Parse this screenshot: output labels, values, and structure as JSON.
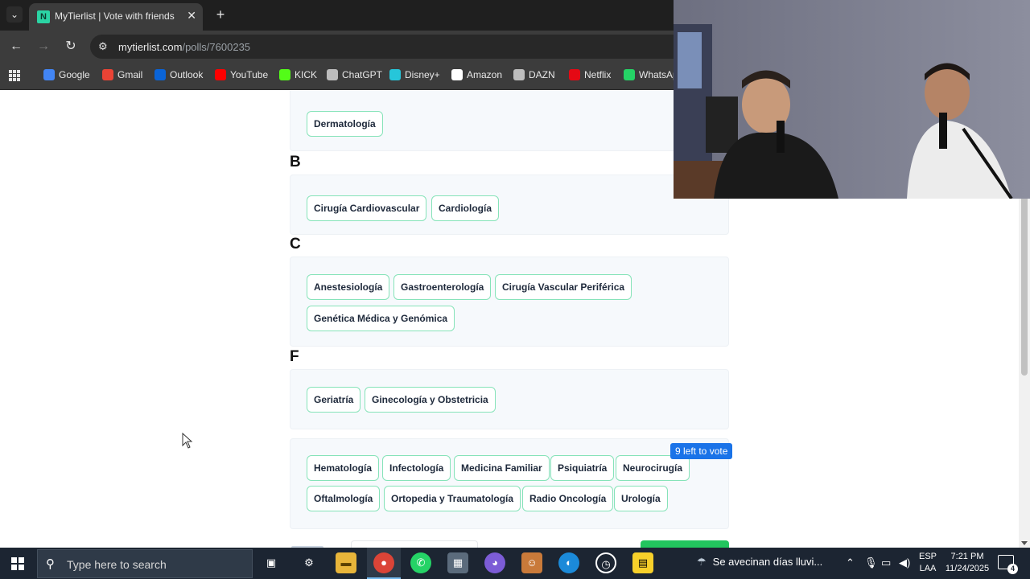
{
  "browser": {
    "tab_title": "MyTierlist | Vote with friends",
    "url_domain": "mytierlist.com",
    "url_path": "/polls/7600235",
    "bookmarks": [
      {
        "label": "Google",
        "icon": "google-icon",
        "color": "#4285f4"
      },
      {
        "label": "Gmail",
        "icon": "gmail-icon",
        "color": "#ea4335"
      },
      {
        "label": "Outlook",
        "icon": "outlook-icon",
        "color": "#0a64d8"
      },
      {
        "label": "YouTube",
        "icon": "youtube-icon",
        "color": "#ff0000"
      },
      {
        "label": "KICK",
        "icon": "kick-icon",
        "color": "#53fc18"
      },
      {
        "label": "ChatGPT",
        "icon": "chatgpt-icon",
        "color": "#bdbdbd"
      },
      {
        "label": "Disney+",
        "icon": "disney-icon",
        "color": "#26c6da"
      },
      {
        "label": "Amazon",
        "icon": "amazon-icon",
        "color": "#ffffff"
      },
      {
        "label": "DAZN",
        "icon": "dazn-icon",
        "color": "#bdbdbd"
      },
      {
        "label": "Netflix",
        "icon": "netflix-icon",
        "color": "#e50914"
      },
      {
        "label": "WhatsAp",
        "icon": "whatsapp-icon",
        "color": "#25d366"
      }
    ]
  },
  "tierlist": {
    "tiers": [
      {
        "label": "",
        "items": [
          "Dermatología"
        ]
      },
      {
        "label": "B",
        "items": [
          "Cirugía Cardiovascular",
          "Cardiología"
        ]
      },
      {
        "label": "C",
        "items": [
          "Anestesiología",
          "Gastroenterología",
          "Cirugía Vascular Periférica",
          "Genética Médica y Genómica"
        ]
      },
      {
        "label": "F",
        "items": [
          "Geriatría",
          "Ginecología y Obstetricia"
        ]
      }
    ],
    "unranked": {
      "badge": "9 left to vote",
      "items": [
        "Hematología",
        "Infectología",
        "Medicina Familiar",
        "Psiquiatría",
        "Neurocirugía",
        "Oftalmología",
        "Ortopedia y Traumatología",
        "Radio Oncología",
        "Urología"
      ]
    }
  },
  "taskbar": {
    "search_placeholder": "Type here to search",
    "weather_text": "Se avecinan días lluvi...",
    "lang_top": "ESP",
    "lang_bottom": "LAA",
    "time": "7:21 PM",
    "date": "11/24/2025",
    "notifications_count": "4"
  },
  "colors": {
    "chip_border": "#86e3b9",
    "badge_bg": "#1a73e8",
    "taskbar_bg": "#1c2532"
  }
}
